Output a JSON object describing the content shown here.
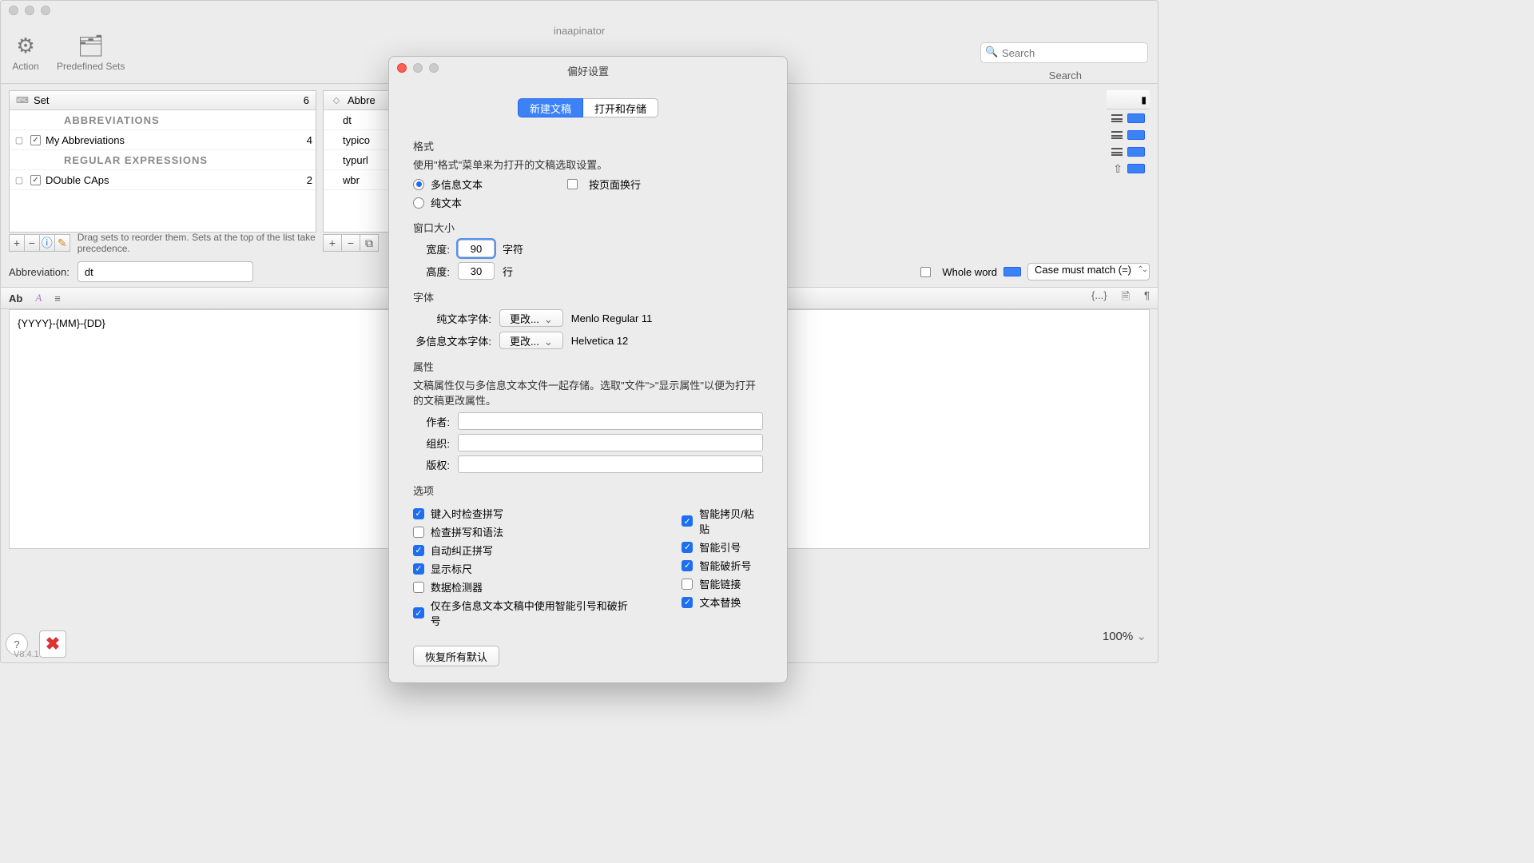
{
  "window": {
    "title": "inaapinator"
  },
  "toolbar": {
    "action": "Action",
    "predefined": "Predefined Sets",
    "search_placeholder": "Search",
    "search_label": "Search"
  },
  "sets": {
    "header_set": "Set",
    "header_count": "6",
    "section1": "ABBREVIATIONS",
    "row1": "My Abbreviations",
    "row1_count": "4",
    "section2": "REGULAR EXPRESSIONS",
    "row2": "DOuble CAps",
    "row2_count": "2",
    "hint": "Drag sets to reorder them. Sets at the top of the list take precedence."
  },
  "abbr_list": {
    "header": "Abbre",
    "items": [
      "dt",
      "typico",
      "typurl",
      "wbr"
    ]
  },
  "abbr_bar": {
    "label": "Abbreviation:",
    "value": "dt",
    "whole_word": "Whole word",
    "case_match": "Case must match (=)"
  },
  "editor": {
    "tab_ab": "Ab",
    "content": "{YYYY}-{MM}-{DD}",
    "placeholder_btn": "{...}"
  },
  "footer": {
    "version": "V8.4.1",
    "zoom": "100%"
  },
  "prefs": {
    "title": "偏好设置",
    "tab_new": "新建文稿",
    "tab_open": "打开和存储",
    "format_title": "格式",
    "format_desc": "使用\"格式\"菜单来为打开的文稿选取设置。",
    "rich_text": "多信息文本",
    "page_wrap": "按页面换行",
    "plain_text": "纯文本",
    "winsize_title": "窗口大小",
    "width_label": "宽度:",
    "width_val": "90",
    "width_unit": "字符",
    "height_label": "高度:",
    "height_val": "30",
    "height_unit": "行",
    "font_title": "字体",
    "plain_font_label": "纯文本字体:",
    "rich_font_label": "多信息文本字体:",
    "change_btn": "更改...",
    "plain_font_value": "Menlo Regular 11",
    "rich_font_value": "Helvetica 12",
    "attr_title": "属性",
    "attr_desc": "文稿属性仅与多信息文本文件一起存储。选取\"文件\">\"显示属性\"以便为打开的文稿更改属性。",
    "author": "作者:",
    "org": "组织:",
    "copyright": "版权:",
    "options_title": "选项",
    "opt_check_spelling": "键入时检查拼写",
    "opt_check_grammar": "检查拼写和语法",
    "opt_autocorrect": "自动纠正拼写",
    "opt_show_ruler": "显示标尺",
    "opt_data_detect": "数据检测器",
    "opt_rich_only": "仅在多信息文本文稿中使用智能引号和破折号",
    "opt_smart_paste": "智能拷贝/粘贴",
    "opt_smart_quotes": "智能引号",
    "opt_smart_dashes": "智能破折号",
    "opt_smart_links": "智能链接",
    "opt_text_replace": "文本替换",
    "restore": "恢复所有默认"
  }
}
